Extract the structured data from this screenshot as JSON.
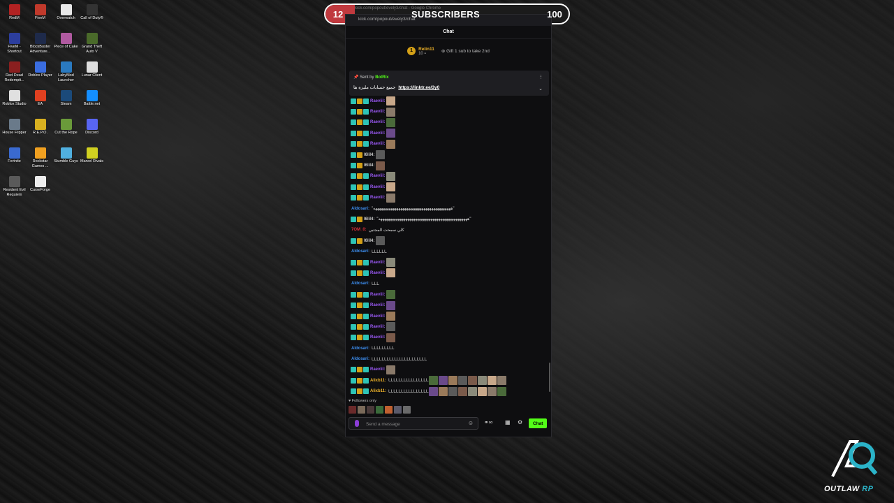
{
  "desktop_icons": [
    {
      "label": "RedM",
      "color": "#b22222"
    },
    {
      "label": "FiveM",
      "color": "#c0392b"
    },
    {
      "label": "Overwatch",
      "color": "#e8e8e8"
    },
    {
      "label": "Call of Duty®",
      "color": "#333333"
    },
    {
      "label": "FiveM - Shortcut",
      "color": "#2c3e9e"
    },
    {
      "label": "BlockBuster Adventure...",
      "color": "#1e2a4a"
    },
    {
      "label": "Piece of Cake",
      "color": "#b05aa0"
    },
    {
      "label": "Grand Theft Auto V",
      "color": "#4a6a2a"
    },
    {
      "label": "Red Dead Redempti...",
      "color": "#8a1f1f"
    },
    {
      "label": "Roblox Player",
      "color": "#3a6de0"
    },
    {
      "label": "LabyMod Launcher",
      "color": "#2a7ac0"
    },
    {
      "label": "Lunar Client",
      "color": "#dddddd"
    },
    {
      "label": "Roblox Studio",
      "color": "#e0e0e0"
    },
    {
      "label": "EA",
      "color": "#e04020"
    },
    {
      "label": "Steam",
      "color": "#1b4a7a"
    },
    {
      "label": "Battle.net",
      "color": "#148eff"
    },
    {
      "label": "House Flipper",
      "color": "#6a7a8a"
    },
    {
      "label": "R.E.P.O.",
      "color": "#d8b020"
    },
    {
      "label": "Cut the Rope",
      "color": "#6a9a3a"
    },
    {
      "label": "Discord",
      "color": "#5865f2"
    },
    {
      "label": "Fortnite",
      "color": "#3a6ad0"
    },
    {
      "label": "Rockstar Games ...",
      "color": "#f0a020"
    },
    {
      "label": "Stumble Guys",
      "color": "#50b0e0"
    },
    {
      "label": "Marvel Rivals",
      "color": "#d0d020"
    },
    {
      "label": "Resident Evil Requiem",
      "color": "#5a5a5a"
    },
    {
      "label": "CurseForge",
      "color": "#eeeeee"
    }
  ],
  "sub_goal": {
    "current": "12",
    "title": "SUBSCRIBERS",
    "goal": "100",
    "progress_fraction": 0.12,
    "window_title": "kick.com/popout/evely3/chat - Google Chrome",
    "fill_color": "#c0393e"
  },
  "chat": {
    "url": "kick.com/popout/evely3/chat",
    "header": "Chat",
    "leader_rank": "1",
    "leader_name": "Relin11",
    "leader_points": "10",
    "gift_text": "Gift 1 sub to take 2nd",
    "pinned_sent_by": "Sent by",
    "pinned_user": "BotRix",
    "pinned_text": "جميع حسابات مليزه ها",
    "pinned_link": "https://linktr.ee/3y0",
    "followers_only": "Followers only",
    "placeholder": "Send a message",
    "send_label": "Chat",
    "accent": "#53fc18",
    "messages": [
      {
        "user": "Raeviil:",
        "color": "#9b59f6",
        "badges": 3,
        "emotes": 1,
        "text": ""
      },
      {
        "user": "Raeviil:",
        "color": "#9b59f6",
        "badges": 3,
        "emotes": 1,
        "text": ""
      },
      {
        "user": "Raeviil:",
        "color": "#9b59f6",
        "badges": 3,
        "emotes": 1,
        "text": ""
      },
      {
        "user": "Raeviil:",
        "color": "#9b59f6",
        "badges": 3,
        "emotes": 1,
        "text": ""
      },
      {
        "user": "Raeviil:",
        "color": "#9b59f6",
        "badges": 3,
        "emotes": 1,
        "text": ""
      },
      {
        "user": "l6lil4:",
        "color": "#cccccc",
        "badges": 2,
        "emotes": 1,
        "text": ""
      },
      {
        "user": "l6lil4:",
        "color": "#cccccc",
        "badges": 2,
        "emotes": 1,
        "text": ""
      },
      {
        "user": "Raeviil:",
        "color": "#9b59f6",
        "badges": 3,
        "emotes": 1,
        "text": ""
      },
      {
        "user": "Raeviil:",
        "color": "#9b59f6",
        "badges": 3,
        "emotes": 1,
        "text": ""
      },
      {
        "user": "Raeviil:",
        "color": "#9b59f6",
        "badges": 3,
        "emotes": 1,
        "text": ""
      },
      {
        "user": "Aldosari:",
        "color": "#3d8ef0",
        "badges": 0,
        "emotes": 0,
        "text": "\"ههههههههههههههههههههههههههههههههههههههههه\""
      },
      {
        "user": "l6lil4:",
        "color": "#cccccc",
        "badges": 2,
        "emotes": 0,
        "text": "\"ههههههههههههههههههههههههههههههههههههههههههههههه\""
      },
      {
        "user": "7OM_0:",
        "color": "#e0303a",
        "badges": 0,
        "emotes": 0,
        "text": "كلي سمحت المجتبي"
      },
      {
        "user": "l6lil4:",
        "color": "#cccccc",
        "badges": 2,
        "emotes": 1,
        "text": ""
      },
      {
        "user": "Aldosari:",
        "color": "#3d8ef0",
        "badges": 0,
        "emotes": 0,
        "text": "ـاـاـاـاـاـا"
      },
      {
        "user": "Raeviil:",
        "color": "#9b59f6",
        "badges": 3,
        "emotes": 1,
        "text": ""
      },
      {
        "user": "Raeviil:",
        "color": "#9b59f6",
        "badges": 3,
        "emotes": 1,
        "text": ""
      },
      {
        "user": "Aldosari:",
        "color": "#3d8ef0",
        "badges": 0,
        "emotes": 0,
        "text": "ـاـاـا"
      },
      {
        "user": "Raeviil:",
        "color": "#9b59f6",
        "badges": 3,
        "emotes": 1,
        "text": ""
      },
      {
        "user": "Raeviil:",
        "color": "#9b59f6",
        "badges": 3,
        "emotes": 1,
        "text": ""
      },
      {
        "user": "Raeviil:",
        "color": "#9b59f6",
        "badges": 3,
        "emotes": 1,
        "text": ""
      },
      {
        "user": "Raeviil:",
        "color": "#9b59f6",
        "badges": 3,
        "emotes": 1,
        "text": ""
      },
      {
        "user": "Raeviil:",
        "color": "#9b59f6",
        "badges": 3,
        "emotes": 1,
        "text": ""
      },
      {
        "user": "Aldosari:",
        "color": "#3d8ef0",
        "badges": 0,
        "emotes": 0,
        "text": "ـاـاـاـاـاـاـاـاـا"
      },
      {
        "user": "Aldosari:",
        "color": "#3d8ef0",
        "badges": 0,
        "emotes": 0,
        "text": "ـاـاـاـاـاـاـاـاـاـاـاـاـاـاـاـاـاـاـاـاـاـا"
      },
      {
        "user": "Raeviil:",
        "color": "#9b59f6",
        "badges": 3,
        "emotes": 1,
        "text": ""
      },
      {
        "user": "Alixb11:",
        "color": "#f0b429",
        "badges": 3,
        "emotes": 8,
        "text": "ـاـاـاـاـاـاـاـاـاـاـاـاـاـاـاـا"
      },
      {
        "user": "Alixb11:",
        "color": "#f0b429",
        "badges": 3,
        "emotes": 8,
        "text": "ـاـاـاـاـاـاـاـاـاـاـاـاـاـاـاـا"
      }
    ]
  },
  "logo": {
    "text_a": "OUTLAW",
    "text_b": "RP"
  }
}
